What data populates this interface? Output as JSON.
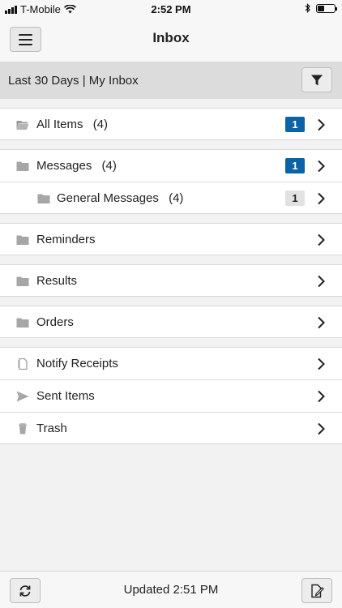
{
  "status_bar": {
    "carrier": "T-Mobile",
    "time": "2:52 PM",
    "icons": [
      "signal-icon",
      "wifi-icon",
      "bluetooth-icon",
      "battery-icon"
    ]
  },
  "header": {
    "title": "Inbox",
    "menu_icon": "hamburger-menu-icon"
  },
  "filter_bar": {
    "label": "Last 30 Days | My Inbox",
    "filter_icon": "filter-funnel-icon"
  },
  "folders": {
    "all_items": {
      "label": "All Items",
      "count": "(4)",
      "badge": "1",
      "icon": "folder-open-icon"
    },
    "messages": {
      "label": "Messages",
      "count": "(4)",
      "badge": "1",
      "icon": "folder-icon"
    },
    "general_messages": {
      "label": "General Messages",
      "count": "(4)",
      "badge": "1",
      "icon": "folder-icon"
    },
    "reminders": {
      "label": "Reminders",
      "icon": "folder-icon"
    },
    "results": {
      "label": "Results",
      "icon": "folder-icon"
    },
    "orders": {
      "label": "Orders",
      "icon": "folder-icon"
    },
    "notify_receipts": {
      "label": "Notify Receipts",
      "icon": "document-icon"
    },
    "sent_items": {
      "label": "Sent Items",
      "icon": "send-icon"
    },
    "trash": {
      "label": "Trash",
      "icon": "trash-icon"
    }
  },
  "footer": {
    "updated": "Updated 2:51 PM",
    "refresh_icon": "refresh-icon",
    "compose_icon": "compose-icon"
  },
  "colors": {
    "badge_blue": "#0b62a4",
    "badge_grey": "#e2e2e2",
    "filter_bar_bg": "#dcdcdc",
    "page_bg": "#f2f2f2"
  }
}
